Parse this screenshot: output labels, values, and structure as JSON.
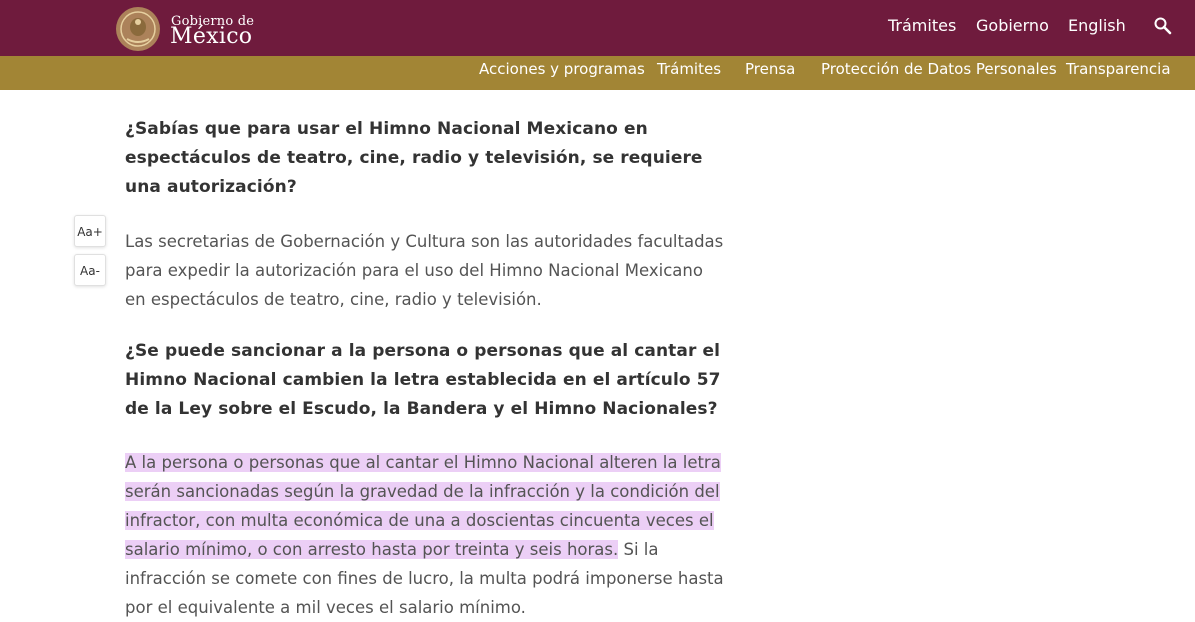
{
  "header": {
    "logo_small": "Gobierno de",
    "logo_big": "México",
    "nav": [
      "Trámites",
      "Gobierno",
      "English"
    ],
    "search_icon": "search-icon",
    "bg_color": "#6f1b3d"
  },
  "subnav": {
    "items": [
      "Acciones y programas",
      "Trámites",
      "Prensa",
      "Protección de Datos Personales",
      "Transparencia"
    ],
    "bg_color": "#a28535"
  },
  "font_controls": {
    "increase": "Aa+",
    "decrease": "Aa-"
  },
  "content": {
    "q1": "¿Sabías que para usar el Himno Nacional Mexicano en espectáculos de teatro, cine, radio y televisión, se requiere una autorización?",
    "a1": "Las secretarias de Gobernación y Cultura son las autoridades facultadas para expedir la autorización para el uso del Himno Nacional Mexicano en espectáculos de teatro, cine, radio y televisión.",
    "q2": "¿Se puede sancionar a la persona o personas que al cantar el Himno Nacional cambien la letra establecida en el artículo 57 de la Ley sobre el Escudo, la Bandera y el Himno Nacionales?",
    "a2_highlighted": "A la persona o personas que al cantar el Himno Nacional alteren la letra serán sancionadas según la gravedad de la infracción y la condición del infractor, con multa económica de una a doscientas cincuenta veces el salario mínimo, o con arresto hasta por treinta y seis horas.",
    "a2_rest": " Si la infracción se comete con fines de lucro, la multa podrá imponerse hasta por el equivalente a mil veces el salario mínimo.",
    "highlight_color": "#eccff6"
  }
}
